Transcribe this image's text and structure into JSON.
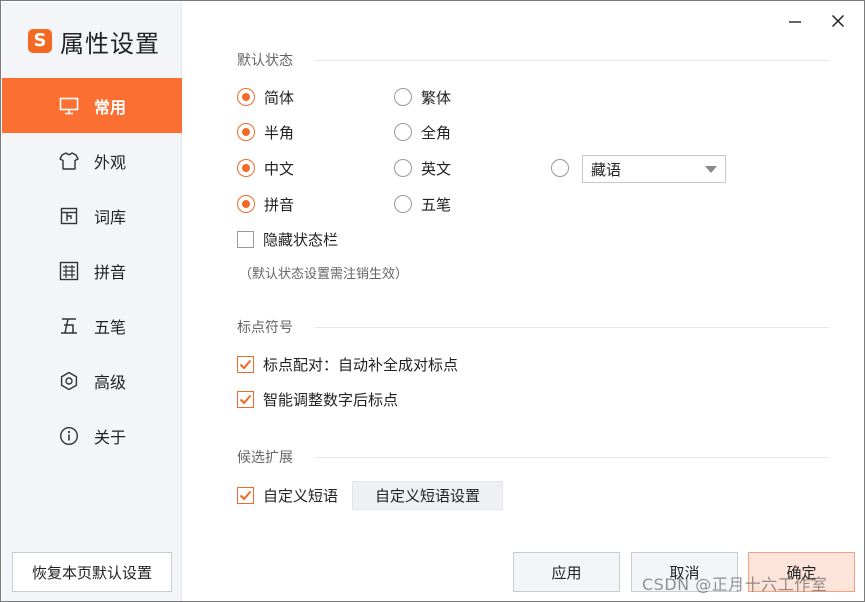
{
  "app": {
    "title": "属性设置",
    "logo_char": "S"
  },
  "window_controls": {
    "minimize": "—",
    "close": "✕"
  },
  "sidebar": {
    "items": [
      {
        "label": "常用",
        "icon": "monitor-icon",
        "active": true
      },
      {
        "label": "外观",
        "icon": "shirt-icon",
        "active": false
      },
      {
        "label": "词库",
        "icon": "book-icon",
        "active": false
      },
      {
        "label": "拼音",
        "icon": "pinyin-icon",
        "active": false
      },
      {
        "label": "五笔",
        "icon": "wubi-icon",
        "active": false
      },
      {
        "label": "高级",
        "icon": "gear-icon",
        "active": false
      },
      {
        "label": "关于",
        "icon": "info-icon",
        "active": false
      }
    ],
    "restore_label": "恢复本页默认设置"
  },
  "default_state": {
    "title": "默认状态",
    "simplified": "简体",
    "traditional": "繁体",
    "halfwidth": "半角",
    "fullwidth": "全角",
    "chinese": "中文",
    "english": "英文",
    "other_lang_selected": "藏语",
    "pinyin": "拼音",
    "wubi": "五笔",
    "hide_statusbar": "隐藏状态栏",
    "note": "（默认状态设置需注销生效）"
  },
  "punctuation": {
    "title": "标点符号",
    "auto_pair": "标点配对：自动补全成对标点",
    "smart_after_number": "智能调整数字后标点"
  },
  "candidates": {
    "title": "候选扩展",
    "custom_phrase": "自定义短语",
    "custom_phrase_settings": "自定义短语设置"
  },
  "footer": {
    "apply": "应用",
    "cancel": "取消",
    "ok": "确定"
  },
  "watermark": "CSDN @正月十六工作室",
  "colors": {
    "accent": "#fc6f32",
    "check": "#f26a2a",
    "sidebar_bg": "#f4f5f9"
  }
}
